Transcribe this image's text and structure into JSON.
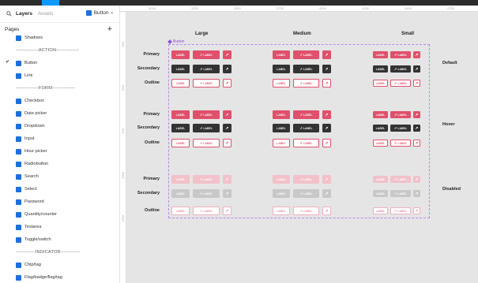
{
  "panel": {
    "tabs": [
      "Layers",
      "Assets"
    ],
    "component": "Button",
    "pages_title": "Pages",
    "items": [
      {
        "label": "Shadows",
        "type": "page"
      },
      {
        "label": "--------------ACTION--------------",
        "type": "sep"
      },
      {
        "label": "Button",
        "type": "page",
        "checked": true
      },
      {
        "label": "Link",
        "type": "page"
      },
      {
        "label": "--------------FORM--------------",
        "type": "sep"
      },
      {
        "label": "Checkbox",
        "type": "page"
      },
      {
        "label": "Date picker",
        "type": "page"
      },
      {
        "label": "Dropdown",
        "type": "page"
      },
      {
        "label": "Input",
        "type": "page"
      },
      {
        "label": "Hour picker",
        "type": "page"
      },
      {
        "label": "Radiobutton",
        "type": "page"
      },
      {
        "label": "Search",
        "type": "page"
      },
      {
        "label": "Select",
        "type": "page"
      },
      {
        "label": "Password",
        "type": "page"
      },
      {
        "label": "Quantity/counter",
        "type": "page"
      },
      {
        "label": "Textarea",
        "type": "page"
      },
      {
        "label": "Toggle/switch",
        "type": "page"
      },
      {
        "label": "------------INDICATOR------------",
        "type": "sep"
      },
      {
        "label": "Chip/tag",
        "type": "page"
      },
      {
        "label": "Flag/badge/flag/tag",
        "type": "page"
      }
    ]
  },
  "ruler": {
    "h": [
      "3000",
      "3250",
      "3500",
      "3750",
      "4000",
      "4250",
      "4500",
      "4750"
    ],
    "v": [
      "250",
      "500",
      "750",
      "1000",
      "1250"
    ]
  },
  "canvas": {
    "frame_label": "Button",
    "columns": [
      "Large",
      "Medium",
      "Small"
    ],
    "rows": [
      "Primary",
      "Secondary",
      "Outline"
    ],
    "states": [
      "Default",
      "Hover",
      "Disabled"
    ],
    "button_text": "LABEL"
  },
  "colors": {
    "primary": "#e0506b",
    "secondary": "#333333",
    "accent": "#0d99ff",
    "frame": "#b88ae8"
  },
  "icons": {
    "search": "search-icon",
    "component": "component-icon",
    "plus": "plus-icon",
    "check": "check-icon"
  }
}
